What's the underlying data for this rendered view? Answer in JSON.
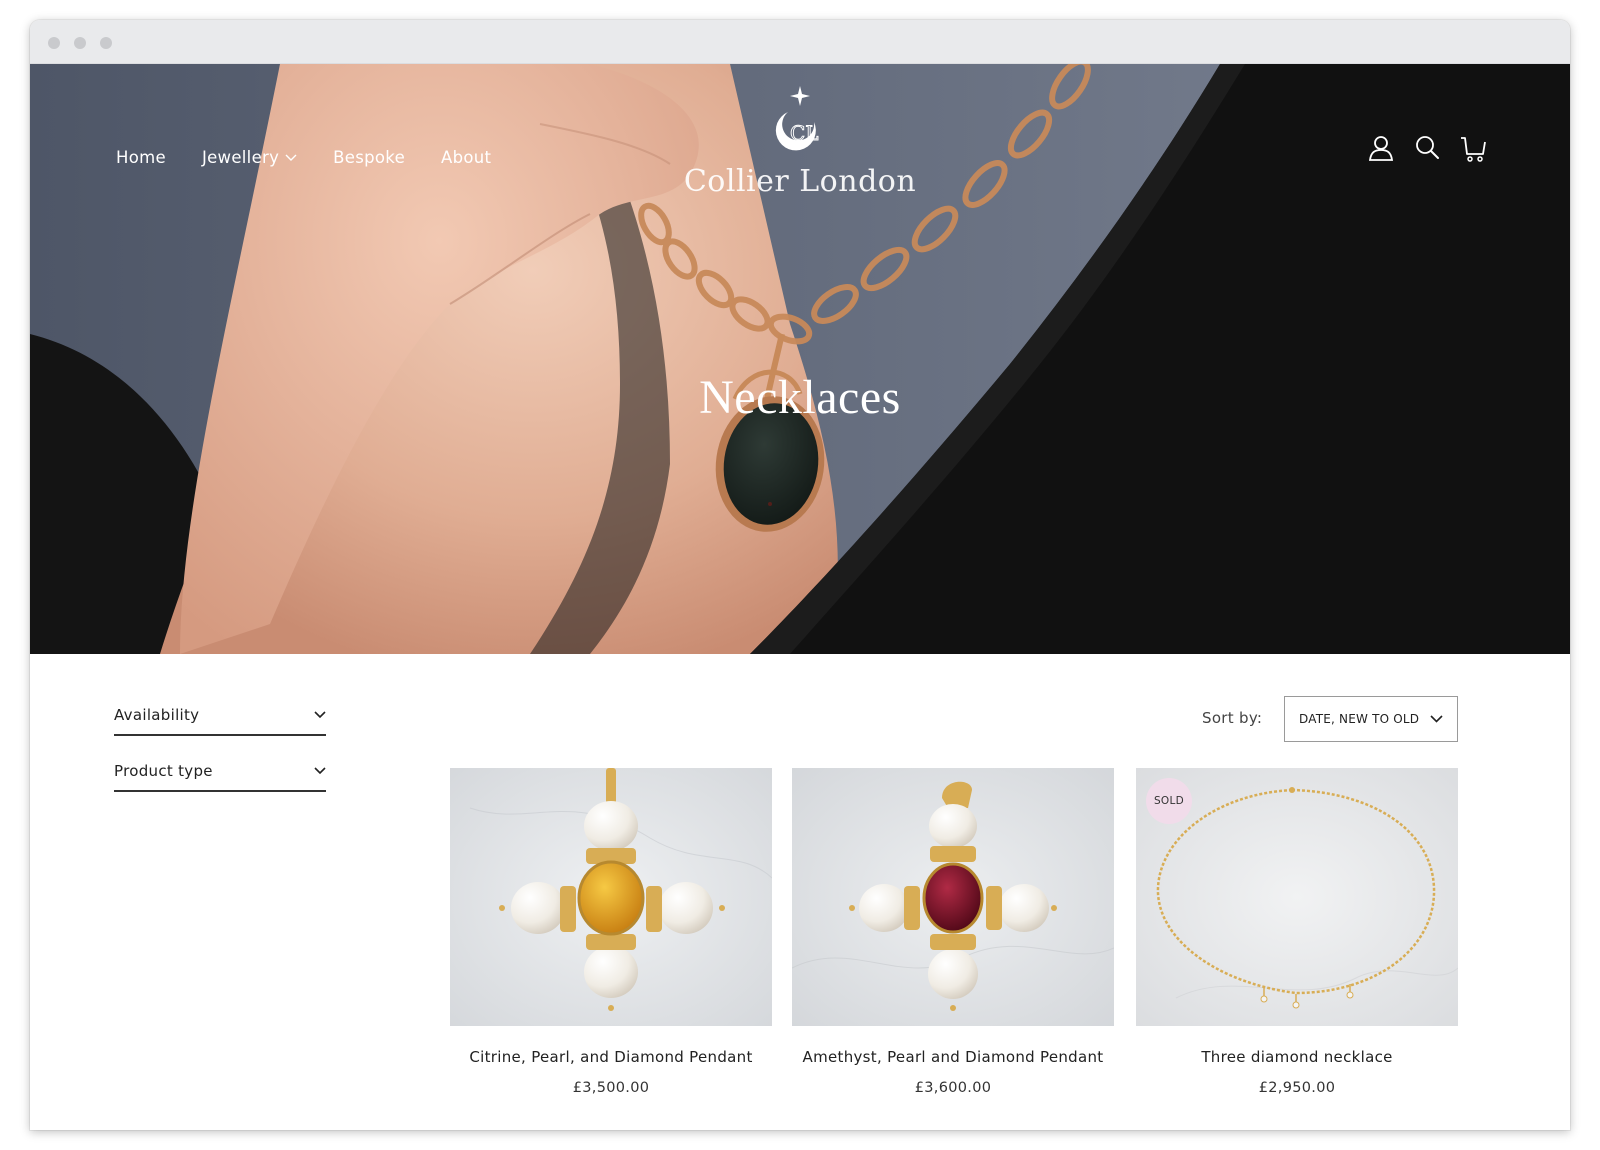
{
  "brand": {
    "name": "Collier London"
  },
  "nav": {
    "items": [
      {
        "label": "Home"
      },
      {
        "label": "Jewellery"
      },
      {
        "label": "Bespoke"
      },
      {
        "label": "About"
      }
    ]
  },
  "header_icons": [
    "account-icon",
    "search-icon",
    "cart-icon"
  ],
  "hero": {
    "title": "Necklaces"
  },
  "filters": [
    {
      "label": "Availability"
    },
    {
      "label": "Product type"
    }
  ],
  "sort": {
    "label": "Sort by:",
    "value": "DATE, NEW TO OLD"
  },
  "products": [
    {
      "name": "Citrine, Pearl, and Diamond Pendant",
      "price": "£3,500.00",
      "badge": ""
    },
    {
      "name": "Amethyst, Pearl and Diamond Pendant",
      "price": "£3,600.00",
      "badge": ""
    },
    {
      "name": "Three diamond necklace",
      "price": "£2,950.00",
      "badge": "SOLD"
    }
  ],
  "colors": {
    "citrine": "#e3a019",
    "amethyst": "#7a1226",
    "gold": "#d8ad55",
    "sold_badge": "#f1dcea"
  }
}
